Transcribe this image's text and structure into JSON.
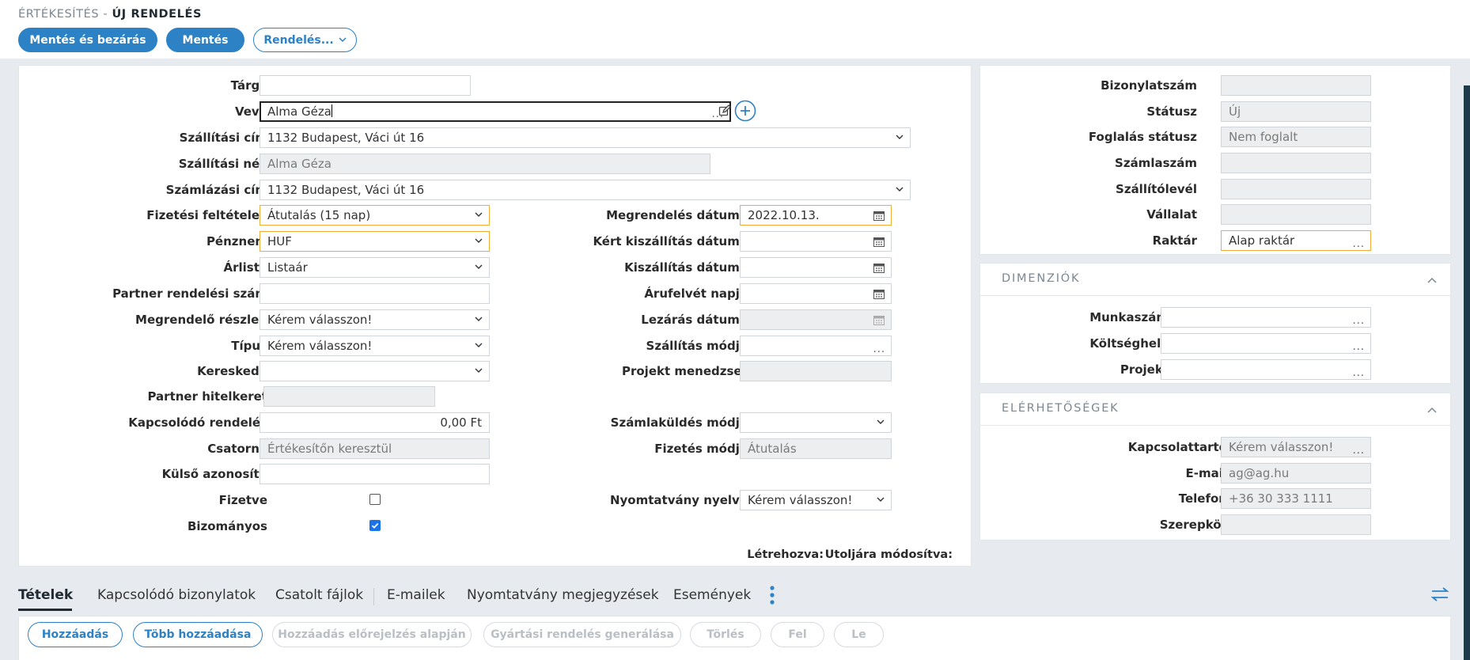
{
  "header": {
    "breadcrumb_parent": "ÉRTÉKESÍTÉS -",
    "breadcrumb_current": "ÚJ RENDELÉS",
    "save_close_label": "Mentés és bezárás",
    "save_label": "Mentés",
    "order_menu_label": "Rendelés..."
  },
  "form": {
    "subject": {
      "label": "Tárgy",
      "value": ""
    },
    "customer": {
      "label": "Vevő",
      "value": "Alma Géza"
    },
    "shipping_address": {
      "label": "Szállítási cím",
      "value": "1132 Budapest, Váci út 16"
    },
    "shipping_name": {
      "label": "Szállítási név",
      "value": "Alma Géza"
    },
    "billing_address": {
      "label": "Számlázási cím",
      "value": "1132 Budapest, Váci út 16"
    },
    "payment_terms": {
      "label": "Fizetési feltételek",
      "value": "Átutalás (15 nap)"
    },
    "currency": {
      "label": "Pénznem",
      "value": "HUF"
    },
    "price_list": {
      "label": "Árlista",
      "value": "Listaár"
    },
    "partner_order_number": {
      "label": "Partner rendelési szám",
      "value": ""
    },
    "ordering_department": {
      "label": "Megrendelő részleg",
      "value": "Kérem válasszon!"
    },
    "type": {
      "label": "Típus",
      "value": "Kérem válasszon!"
    },
    "salesperson": {
      "label": "Kereskedő",
      "value": ""
    },
    "partner_credit_limit": {
      "label": "Partner hitelkeret",
      "value": ""
    },
    "related_order": {
      "label": "Kapcsolódó rendelés",
      "value": "0,00 Ft"
    },
    "channel": {
      "label": "Csatorna",
      "value": "Értékesítőn keresztül"
    },
    "external_id": {
      "label": "Külső azonosító",
      "value": ""
    },
    "paid": {
      "label": "Fizetve",
      "checked": false
    },
    "commission": {
      "label": "Bizományos",
      "checked": true
    },
    "order_date": {
      "label": "Megrendelés dátuma",
      "value": "2022.10.13."
    },
    "requested_delivery_date": {
      "label": "Kért kiszállítás dátuma",
      "value": ""
    },
    "delivery_date": {
      "label": "Kiszállítás dátuma",
      "value": ""
    },
    "goods_receipt_day": {
      "label": "Árufelvét napja",
      "value": ""
    },
    "closing_date": {
      "label": "Lezárás dátuma",
      "value": ""
    },
    "shipping_method": {
      "label": "Szállítás módja",
      "value": ""
    },
    "project_manager": {
      "label": "Projekt menedzser",
      "value": ""
    },
    "invoice_sending_method": {
      "label": "Számlaküldés módja",
      "value": ""
    },
    "payment_method": {
      "label": "Fizetés módja",
      "value": "Átutalás"
    },
    "print_language": {
      "label": "Nyomtatvány nyelve",
      "value": "Kérem válasszon!"
    },
    "created_label": "Létrehozva:",
    "modified_label": "Utoljára módosítva:"
  },
  "side": {
    "document_number": {
      "label": "Bizonylatszám",
      "value": ""
    },
    "status": {
      "label": "Státusz",
      "value": "Új"
    },
    "reservation_status": {
      "label": "Foglalás státusz",
      "value": "Nem foglalt"
    },
    "invoice_number": {
      "label": "Számlaszám",
      "value": ""
    },
    "delivery_note": {
      "label": "Szállítólevél",
      "value": ""
    },
    "company": {
      "label": "Vállalat",
      "value": ""
    },
    "warehouse": {
      "label": "Raktár",
      "value": "Alap raktár"
    }
  },
  "dimensions": {
    "title": "DIMENZIÓK",
    "job_number": {
      "label": "Munkaszám",
      "value": ""
    },
    "cost_center": {
      "label": "Költséghely",
      "value": ""
    },
    "project": {
      "label": "Projekt",
      "value": ""
    }
  },
  "contacts": {
    "title": "ELÉRHETŐSÉGEK",
    "contact_person": {
      "label": "Kapcsolattartó",
      "value": "Kérem válasszon!"
    },
    "email": {
      "label": "E-mail",
      "value": "ag@ag.hu"
    },
    "phone": {
      "label": "Telefon",
      "value": "+36 30 333 1111"
    },
    "role": {
      "label": "Szerepkör",
      "value": ""
    }
  },
  "tabs": [
    "Tételek",
    "Kapcsolódó bizonylatok",
    "Csatolt fájlok",
    "E-mailek",
    "Nyomtatvány megjegyzések",
    "Események"
  ],
  "toolbar": [
    "Hozzáadás",
    "Több hozzáadása",
    "Hozzáadás előrejelzés alapján",
    "Gyártási rendelés generálása",
    "Törlés",
    "Fel",
    "Le"
  ]
}
